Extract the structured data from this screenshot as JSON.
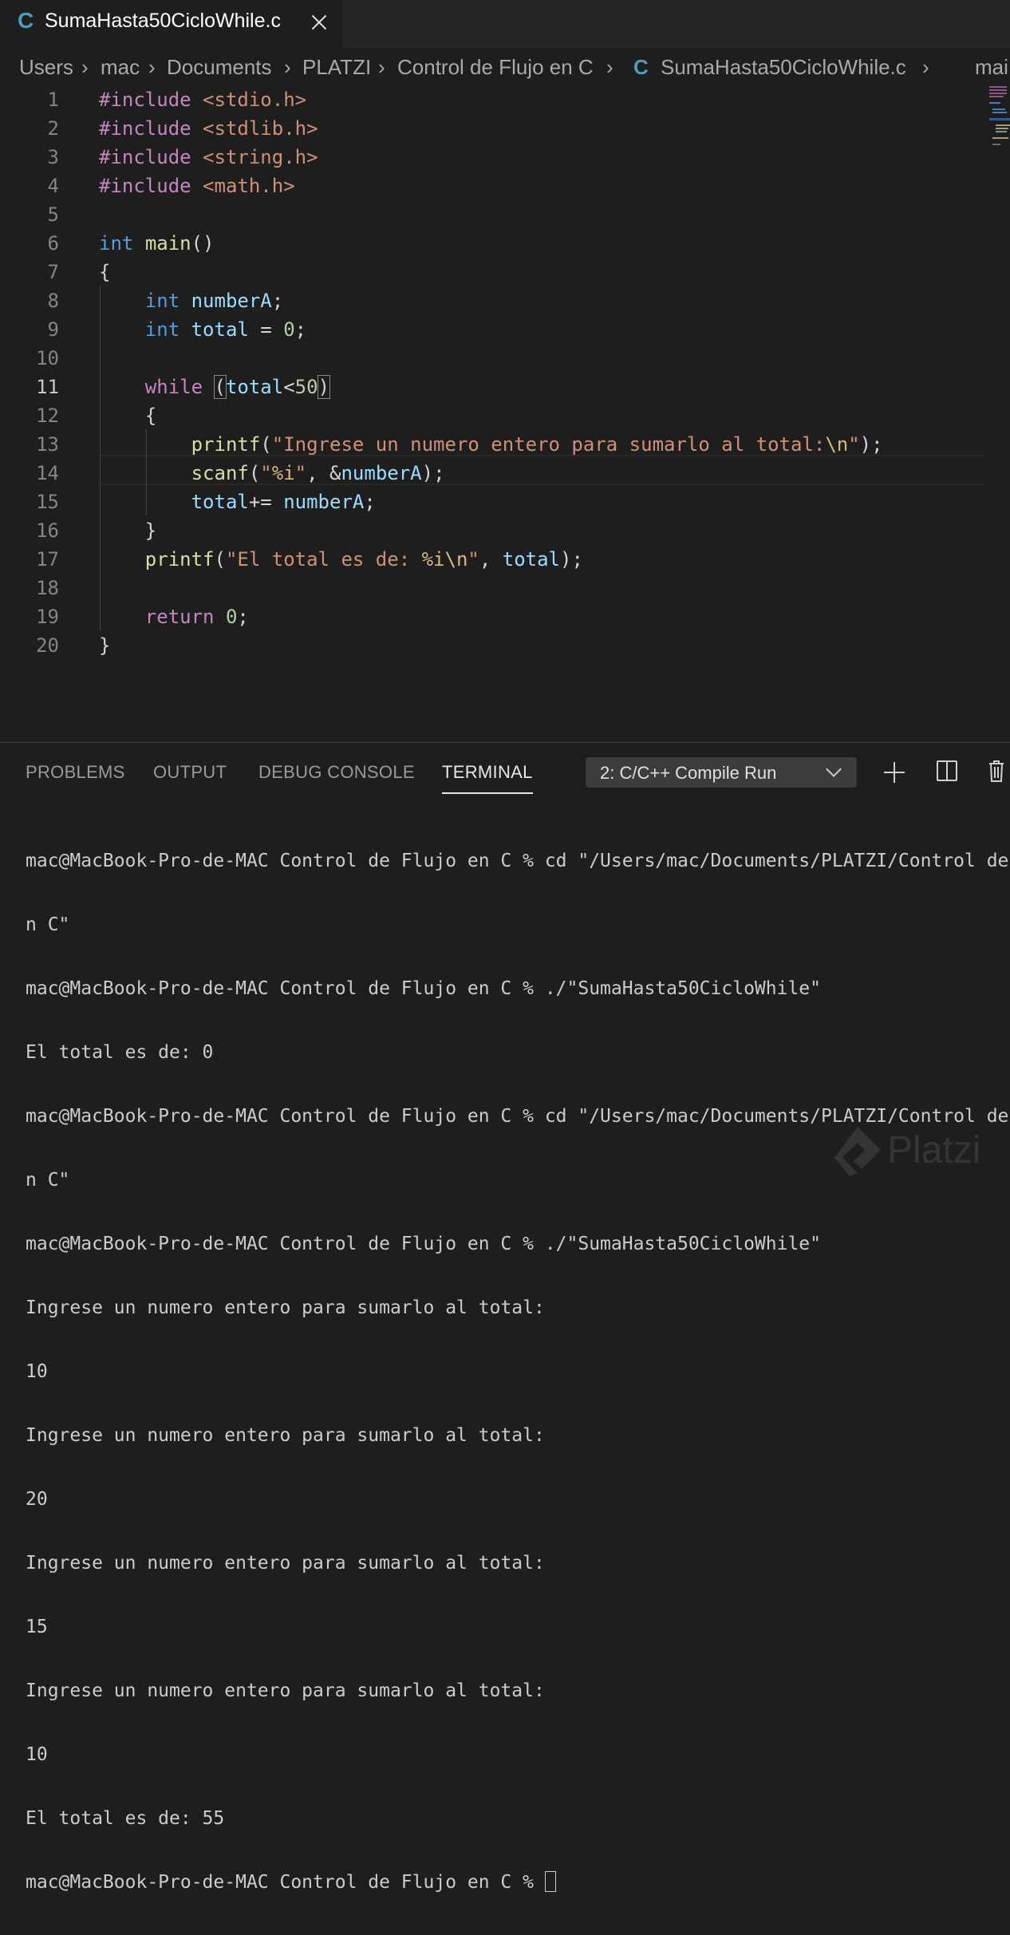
{
  "tab": {
    "icon_text": "C",
    "label": "SumaHasta50CicloWhile.c"
  },
  "breadcrumb": {
    "items": [
      "Users",
      "mac",
      "Documents",
      "PLATZI",
      "Control de Flujo en C",
      "SumaHasta50CicloWhile.c",
      "mai"
    ],
    "file_icon_text": "C"
  },
  "editor": {
    "line_numbers": [
      "1",
      "2",
      "3",
      "4",
      "5",
      "6",
      "7",
      "8",
      "9",
      "10",
      "11",
      "12",
      "13",
      "14",
      "15",
      "16",
      "17",
      "18",
      "19",
      "20"
    ],
    "active_line": "11",
    "lines": {
      "l1": {
        "kw": "#include",
        "hdr": "<stdio.h>"
      },
      "l2": {
        "kw": "#include",
        "hdr": "<stdlib.h>"
      },
      "l3": {
        "kw": "#include",
        "hdr": "<string.h>"
      },
      "l4": {
        "kw": "#include",
        "hdr": "<math.h>"
      },
      "l6": {
        "type": "int",
        "fn": "main",
        "rest": "()"
      },
      "l7": {
        "text": "{"
      },
      "l8": {
        "type": "int",
        "var": "numberA",
        "rest": ";"
      },
      "l9": {
        "type": "int",
        "var": "total",
        "op": " = ",
        "num": "0",
        "rest": ";"
      },
      "l11": {
        "kw": "while",
        "open": "(",
        "var": "total",
        "op": "<",
        "num": "50",
        "close": ")"
      },
      "l12": {
        "text": "{"
      },
      "l13": {
        "fn": "printf",
        "open": "(",
        "str": "\"Ingrese un numero entero para sumarlo al total:",
        "esc": "\\n",
        "strend": "\"",
        "rest": ");"
      },
      "l14": {
        "fn": "scanf",
        "open": "(",
        "str_a": "\"",
        "esc": "%i",
        "str_b": "\"",
        "sep": ", &",
        "var": "numberA",
        "rest": ");"
      },
      "l15": {
        "var": "total",
        "op": "+= ",
        "var2": "numberA",
        "rest": ";"
      },
      "l16": {
        "text": "}"
      },
      "l17": {
        "fn": "printf",
        "open": "(",
        "str": "\"El total es de: ",
        "esc": "%i\\n",
        "strend": "\"",
        "sep": ", ",
        "var": "total",
        "rest": ");"
      },
      "l19": {
        "kw": "return",
        "num": "0",
        "rest": ";"
      },
      "l20": {
        "text": "}"
      }
    }
  },
  "panel": {
    "tabs": [
      "PROBLEMS",
      "OUTPUT",
      "DEBUG CONSOLE",
      "TERMINAL"
    ],
    "active_tab": "TERMINAL",
    "terminal_select": "2: C/C++ Compile Run",
    "terminal_lines": [
      "mac@MacBook-Pro-de-MAC Control de Flujo en C % cd \"/Users/mac/Documents/PLATZI/Control de Flujo e",
      "n C\"",
      "mac@MacBook-Pro-de-MAC Control de Flujo en C % ./\"SumaHasta50CicloWhile\"",
      "El total es de: 0",
      "mac@MacBook-Pro-de-MAC Control de Flujo en C % cd \"/Users/mac/Documents/PLATZI/Control de Flujo e",
      "n C\"",
      "mac@MacBook-Pro-de-MAC Control de Flujo en C % ./\"SumaHasta50CicloWhile\"",
      "Ingrese un numero entero para sumarlo al total:",
      "10",
      "Ingrese un numero entero para sumarlo al total:",
      "20",
      "Ingrese un numero entero para sumarlo al total:",
      "15",
      "Ingrese un numero entero para sumarlo al total:",
      "10",
      "El total es de: 55"
    ],
    "prompt": "mac@MacBook-Pro-de-MAC Control de Flujo en C % "
  },
  "watermark": {
    "text": "Platzi"
  }
}
